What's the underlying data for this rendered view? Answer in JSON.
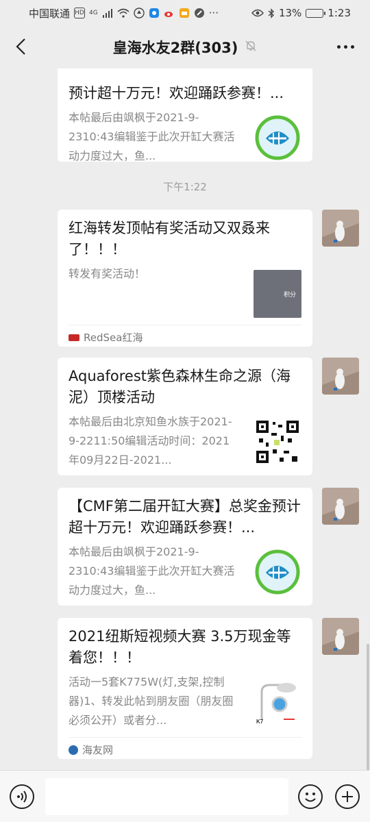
{
  "status_bar": {
    "carrier": "中国联通",
    "network_badge": "HD",
    "network_type": "4G",
    "battery_percent": "13%",
    "battery_level": 0.13,
    "time": "1:23",
    "icons": [
      "signal-icon",
      "wifi-icon",
      "app-icon",
      "weibo-icon",
      "notification-icon",
      "more-icon",
      "eye-icon",
      "bluetooth-icon",
      "battery-icon"
    ]
  },
  "header": {
    "title": "皇海水友2群(303)",
    "muted_icon": "bell-off-icon"
  },
  "messages": [
    {
      "title": "【CMF第二届开缸大赛】总奖金预计超十万元！欢迎踊跃参赛！...",
      "title_visible": "预计超十万元！欢迎踊跃参赛！...",
      "desc": "本帖最后由飒枫于2021-9-2310:43编辑鉴于此次开缸大赛活动力度过大，鱼...",
      "thumb": "fish-logo"
    },
    {
      "timestamp": "下午1:22"
    },
    {
      "title": "红海转发顶帖有奖活动又双叒来了！！！",
      "desc": "转发有奖活动！",
      "thumb": "redsea-banner",
      "thumb_text": "积分",
      "source": "RedSea红海"
    },
    {
      "title": "Aquaforest紫色森林生命之源（海泥）顶楼活动",
      "desc": "本帖最后由北京知鱼水族于2021-9-2211:50编辑活动时间：2021年09月22日-2021...",
      "thumb": "qr-code"
    },
    {
      "title": "【CMF第二届开缸大赛】总奖金预计超十万元！欢迎踊跃参赛！...",
      "desc": "本帖最后由飒枫于2021-9-2310:43编辑鉴于此次开缸大赛活动力度过大，鱼...",
      "thumb": "fish-logo"
    },
    {
      "title": "2021纽斯短视频大赛 3.5万现金等着您！！！",
      "desc": "活动一5套K775W(灯,支架,控制器)1、转发此帖到朋友圈（朋友圈必须公开）或者分...",
      "thumb": "lamp-product",
      "thumb_text": "K7",
      "source": "海友网"
    }
  ],
  "input_bar": {
    "placeholder": ""
  }
}
